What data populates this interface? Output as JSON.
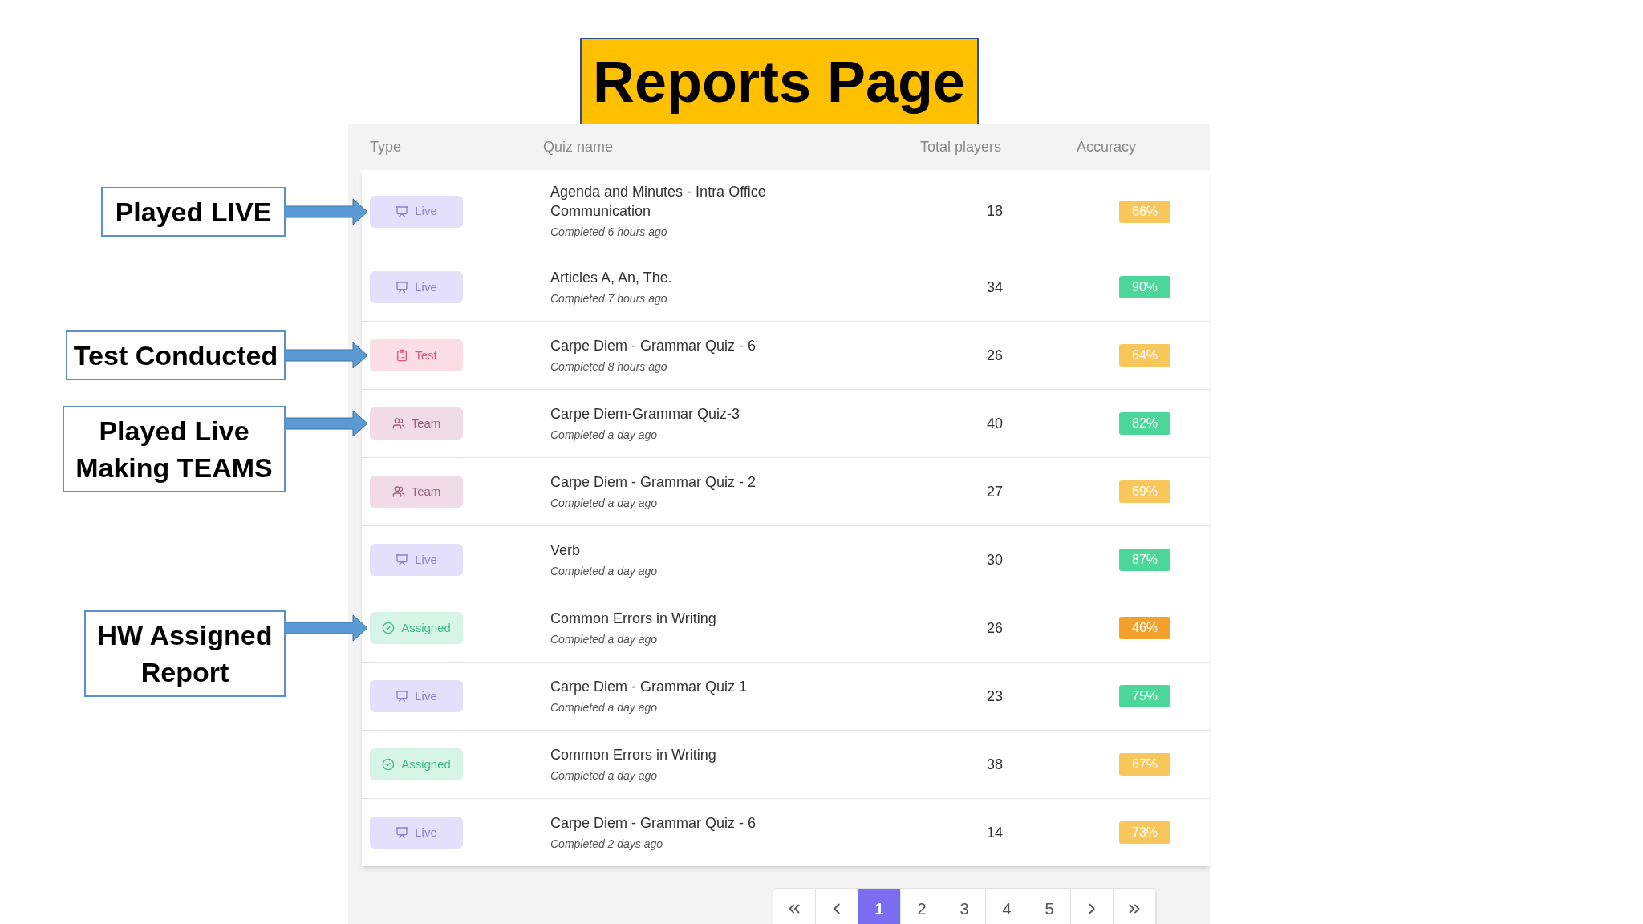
{
  "title": "Reports Page",
  "callouts": [
    {
      "text": "Played LIVE"
    },
    {
      "text": "Test Conducted"
    },
    {
      "text": "Played Live\nMaking TEAMS"
    },
    {
      "text": "HW Assigned\nReport"
    }
  ],
  "table": {
    "columns": [
      "Type",
      "Quiz name",
      "Total players",
      "Accuracy"
    ],
    "rows": [
      {
        "kind": "live",
        "type": "Live",
        "name": "Agenda and Minutes - Intra Office Communication",
        "completed": "Completed 6 hours ago",
        "players": "18",
        "accuracy": "66%",
        "color": "#f8c75c"
      },
      {
        "kind": "live",
        "type": "Live",
        "name": "Articles A, An, The.",
        "completed": "Completed 7 hours ago",
        "players": "34",
        "accuracy": "90%",
        "color": "#4dd69a"
      },
      {
        "kind": "test",
        "type": "Test",
        "name": "Carpe Diem - Grammar Quiz - 6",
        "completed": "Completed 8 hours ago",
        "players": "26",
        "accuracy": "64%",
        "color": "#f8c75c"
      },
      {
        "kind": "team",
        "type": "Team",
        "name": "Carpe Diem-Grammar Quiz-3",
        "completed": "Completed a day ago",
        "players": "40",
        "accuracy": "82%",
        "color": "#4dd69a"
      },
      {
        "kind": "team",
        "type": "Team",
        "name": "Carpe Diem - Grammar Quiz - 2",
        "completed": "Completed a day ago",
        "players": "27",
        "accuracy": "69%",
        "color": "#f8c75c"
      },
      {
        "kind": "live",
        "type": "Live",
        "name": "Verb",
        "completed": "Completed a day ago",
        "players": "30",
        "accuracy": "87%",
        "color": "#4dd69a"
      },
      {
        "kind": "assigned",
        "type": "Assigned",
        "name": "Common Errors in Writing",
        "completed": "Completed a day ago",
        "players": "26",
        "accuracy": "46%",
        "color": "#f2a22c"
      },
      {
        "kind": "live",
        "type": "Live",
        "name": "Carpe Diem - Grammar Quiz 1",
        "completed": "Completed a day ago",
        "players": "23",
        "accuracy": "75%",
        "color": "#4dd69a"
      },
      {
        "kind": "assigned",
        "type": "Assigned",
        "name": "Common Errors in Writing",
        "completed": "Completed a day ago",
        "players": "38",
        "accuracy": "67%",
        "color": "#f8c75c"
      },
      {
        "kind": "live",
        "type": "Live",
        "name": "Carpe Diem - Grammar Quiz - 6",
        "completed": "Completed 2 days ago",
        "players": "14",
        "accuracy": "73%",
        "color": "#f8c75c"
      }
    ]
  },
  "pagination": [
    {
      "kind": "first"
    },
    {
      "kind": "prev"
    },
    {
      "kind": "page",
      "label": "1",
      "selected": true
    },
    {
      "kind": "page",
      "label": "2",
      "selected": false
    },
    {
      "kind": "page",
      "label": "3",
      "selected": false
    },
    {
      "kind": "page",
      "label": "4",
      "selected": false
    },
    {
      "kind": "page",
      "label": "5",
      "selected": false
    },
    {
      "kind": "next"
    },
    {
      "kind": "last"
    }
  ]
}
